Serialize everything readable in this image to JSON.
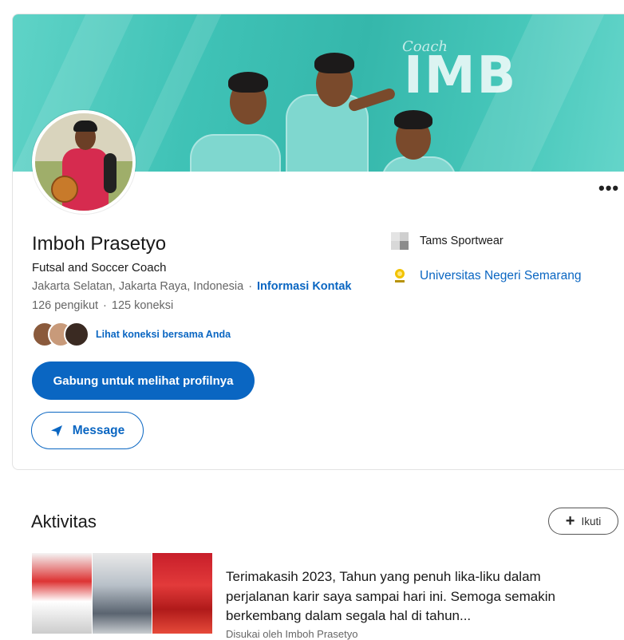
{
  "profile": {
    "name": "Imboh Prasetyo",
    "headline": "Futsal and Soccer Coach",
    "location": "Jakarta Selatan, Jakarta Raya, Indonesia",
    "separator": "·",
    "contact_info_label": "Informasi Kontak",
    "followers": "126 pengikut",
    "connections": "125 koneksi",
    "mutual_connections_label": "Lihat koneksi bersama Anda",
    "join_button_label": "Gabung untuk melihat profilnya",
    "message_button_label": "Message",
    "more_label": "•••"
  },
  "banner": {
    "logo_text": "IMB",
    "script_text": "Coach"
  },
  "experience": [
    {
      "label": "Tams Sportwear",
      "icon": "company-logo-icon"
    },
    {
      "label": "Universitas Negeri Semarang",
      "icon": "university-logo-icon"
    }
  ],
  "activity": {
    "section_title": "Aktivitas",
    "follow_button_label": "Ikuti",
    "post_text": "Terimakasih 2023, Tahun yang penuh lika-liku dalam perjalanan karir saya sampai hari ini. Semoga semakin berkembang dalam segala hal di tahun...",
    "post_subtext": "Disukai oleh Imboh Prasetyo"
  },
  "colors": {
    "accent": "#0a66c2",
    "banner": "#3fc2b6",
    "jersey": "#d62b4f"
  }
}
